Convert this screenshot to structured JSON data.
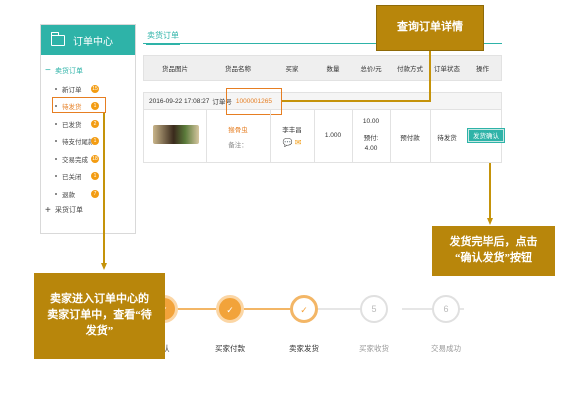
{
  "sidebar": {
    "title": "订单中心",
    "group_sell": "卖货订单",
    "items": [
      {
        "label": "新订单",
        "badge": "15"
      },
      {
        "label": "待发货",
        "badge": "1"
      },
      {
        "label": "已发货",
        "badge": "2"
      },
      {
        "label": "待支付尾款",
        "badge": "1"
      },
      {
        "label": "交易完成",
        "badge": "18"
      },
      {
        "label": "已关闭",
        "badge": "1"
      },
      {
        "label": "退款",
        "badge": "7"
      }
    ],
    "group_buy": "采货订单"
  },
  "tab": {
    "label": "卖货订单"
  },
  "table": {
    "headers": [
      "货品图片",
      "货品名称",
      "买家",
      "数量",
      "总价/元",
      "付款方式",
      "订单状态",
      "操作"
    ]
  },
  "order": {
    "datetime": "2016-09-22 17:08:27",
    "no_label": "订单号",
    "no": "1000001265",
    "product_name": "猴骨虫",
    "note": "备注：",
    "buyer": "李丰昌",
    "qty": "1.000",
    "total": "10.00",
    "prepay": "预付:",
    "prepay_value": "4.00",
    "payment": "预付款",
    "status": "待发货",
    "action": "发货确认"
  },
  "callouts": {
    "detail": "查询订单详情",
    "ship_line1": "发货完毕后，点击",
    "ship_line2": "“确认发货”按钮",
    "seller_line1": "卖家进入订单中心的",
    "seller_line2": "卖家订单中，查看“待",
    "seller_line3": "发货”"
  },
  "steps": [
    {
      "num": "1",
      "label": "确认"
    },
    {
      "num": "2",
      "label": "买家付款"
    },
    {
      "num": "3",
      "label": "卖家发货"
    },
    {
      "num": "5",
      "label": "买家收货"
    },
    {
      "num": "6",
      "label": "交易成功"
    }
  ],
  "colors": {
    "accent": "#2eb3a8",
    "orange": "#e67e22",
    "callout": "#b8860b"
  }
}
